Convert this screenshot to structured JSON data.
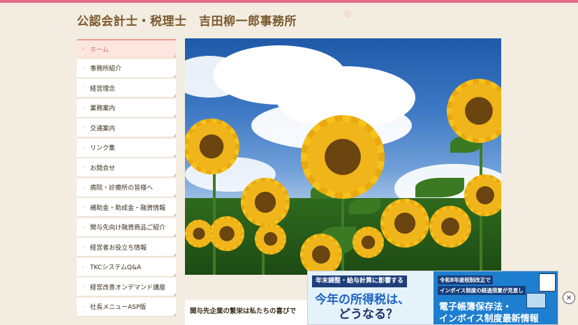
{
  "site": {
    "title": "公認会計士・税理士　吉田柳一郎事務所"
  },
  "nav": {
    "items": [
      {
        "label": "ホーム",
        "active": true
      },
      {
        "label": "事務所紹介"
      },
      {
        "label": "経営理念"
      },
      {
        "label": "業務案内"
      },
      {
        "label": "交通案内"
      },
      {
        "label": "リンク集"
      },
      {
        "label": "お問合せ"
      },
      {
        "label": "病院・診療所の皆様へ"
      },
      {
        "label": "補助金・助成金・融資情報"
      },
      {
        "label": "関与先向け融資商品ご紹介"
      },
      {
        "label": "経営者お役立ち情報"
      },
      {
        "label": "TKCシステムQ&A"
      },
      {
        "label": "経営改善オンデマンド講座"
      },
      {
        "label": "社長メニューASP版"
      }
    ]
  },
  "main": {
    "intro": "関与先企業の繁栄は私たちの喜びで"
  },
  "ad": {
    "left": {
      "tag": "年末調整・給与計算に影響する",
      "headline1": "今年の所得税は、",
      "headline2": "どうなる？"
    },
    "right": {
      "tag1": "令和8年度税制改正で",
      "tag2": "インボイス制度の経過措置が見直し",
      "headline1": "電子帳簿保存法・",
      "headline2": "インボイス制度最新情報"
    },
    "close_label": "×"
  },
  "colors": {
    "accent": "#e46a8c",
    "title": "#7a5a2e",
    "active_nav": "#e06a5a"
  }
}
